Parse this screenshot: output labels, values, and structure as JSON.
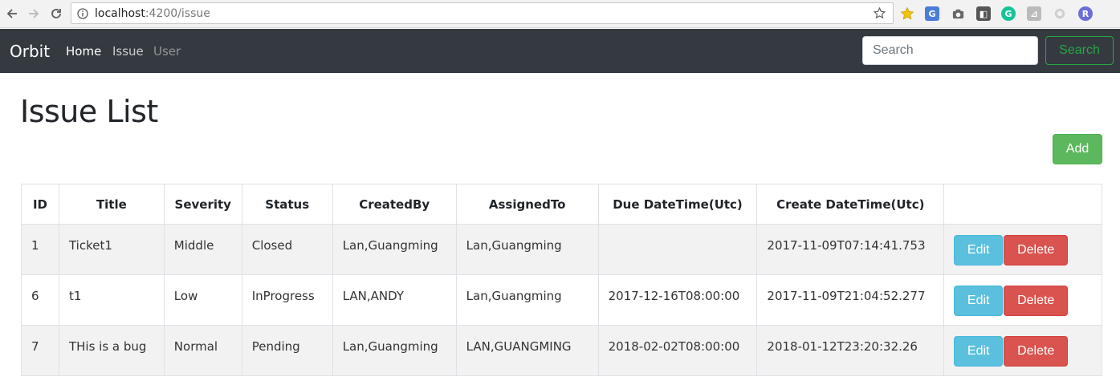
{
  "browser": {
    "url_host": "localhost",
    "url_path": ":4200/issue"
  },
  "navbar": {
    "brand": "Orbit",
    "links": [
      {
        "label": "Home"
      },
      {
        "label": "Issue"
      },
      {
        "label": "User"
      }
    ],
    "search_placeholder": "Search",
    "search_button": "Search"
  },
  "page": {
    "title": "Issue List",
    "add_button": "Add"
  },
  "table": {
    "columns": [
      "ID",
      "Title",
      "Severity",
      "Status",
      "CreatedBy",
      "AssignedTo",
      "Due DateTime(Utc)",
      "Create DateTime(Utc)",
      ""
    ],
    "rows": [
      {
        "id": "1",
        "title": "Ticket1",
        "severity": "Middle",
        "status": "Closed",
        "created_by": "Lan,Guangming",
        "assigned_to": "Lan,Guangming",
        "due": "",
        "created": "2017-11-09T07:14:41.753",
        "edit": "Edit",
        "delete": "Delete"
      },
      {
        "id": "6",
        "title": "t1",
        "severity": "Low",
        "status": "InProgress",
        "created_by": "LAN,ANDY",
        "assigned_to": "Lan,Guangming",
        "due": "2017-12-16T08:00:00",
        "created": "2017-11-09T21:04:52.277",
        "edit": "Edit",
        "delete": "Delete"
      },
      {
        "id": "7",
        "title": "THis is a bug",
        "severity": "Normal",
        "status": "Pending",
        "created_by": "Lan,Guangming",
        "assigned_to": "LAN,GUANGMING",
        "due": "2018-02-02T08:00:00",
        "created": "2018-01-12T23:20:32.26",
        "edit": "Edit",
        "delete": "Delete"
      }
    ]
  },
  "colors": {
    "navbar_bg": "#343a40",
    "success": "#28a745",
    "add_green": "#5cb85c",
    "info": "#5bc0de",
    "danger": "#d9534f"
  },
  "icons": [
    "back-arrow-icon",
    "forward-arrow-icon",
    "reload-icon",
    "info-icon",
    "bookmark-star-icon"
  ]
}
